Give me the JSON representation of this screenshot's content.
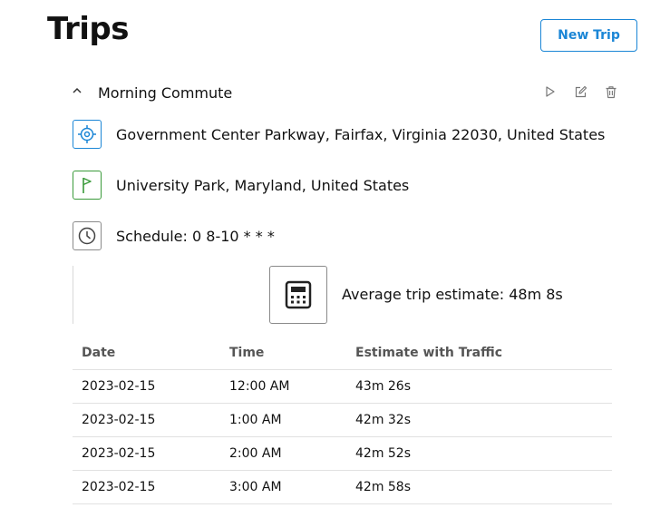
{
  "header": {
    "title": "Trips",
    "new_trip_label": "New Trip"
  },
  "trip": {
    "name": "Morning Commute",
    "origin": "Government Center Parkway, Fairfax, Virginia 22030, United States",
    "destination": "University Park, Maryland, United States",
    "schedule": "Schedule: 0 8-10 * * *",
    "average_estimate": "Average trip estimate: 48m 8s"
  },
  "icons": {
    "origin": "target-icon",
    "destination": "flag-icon",
    "schedule": "clock-icon",
    "calculator": "calculator-icon",
    "collapse": "chevron-up-icon",
    "play": "play-icon",
    "edit": "edit-icon",
    "delete": "trash-icon"
  },
  "colors": {
    "accent": "#1b86d6",
    "origin": "#1b86d6",
    "destination": "#3a9a3a"
  },
  "table": {
    "columns": [
      "Date",
      "Time",
      "Estimate with Traffic"
    ],
    "rows": [
      [
        "2023-02-15",
        "12:00 AM",
        "43m 26s"
      ],
      [
        "2023-02-15",
        "1:00 AM",
        "42m 32s"
      ],
      [
        "2023-02-15",
        "2:00 AM",
        "42m 52s"
      ],
      [
        "2023-02-15",
        "3:00 AM",
        "42m 58s"
      ]
    ]
  }
}
